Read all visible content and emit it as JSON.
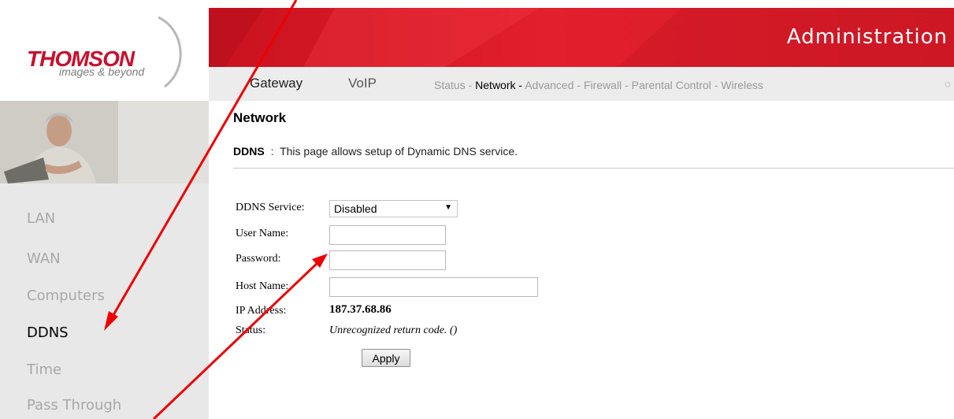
{
  "brand": {
    "logo_text": "THOMSON",
    "tagline": "images & beyond",
    "colors": {
      "primary_red": "#d61a29",
      "logo_red": "#c8102e",
      "annotation_red": "#ee0000"
    }
  },
  "banner": {
    "title": "Administration"
  },
  "nav": {
    "main": [
      "Gateway",
      "VoIP"
    ],
    "sub": [
      {
        "label": "Status",
        "active": false
      },
      {
        "label": "Network",
        "active": true
      },
      {
        "label": "Advanced",
        "active": false
      },
      {
        "label": "Firewall",
        "active": false
      },
      {
        "label": "Parental Control",
        "active": false
      },
      {
        "label": "Wireless",
        "active": false
      }
    ],
    "separator": "-",
    "trailing_icon": "loading-ring-icon"
  },
  "sidebar": {
    "items": [
      {
        "label": "LAN",
        "active": false
      },
      {
        "label": "WAN",
        "active": false
      },
      {
        "label": "Computers",
        "active": false
      },
      {
        "label": "DDNS",
        "active": true
      },
      {
        "label": "Time",
        "active": false
      },
      {
        "label": "Pass Through",
        "active": false
      }
    ]
  },
  "page": {
    "title": "Network",
    "desc_key": "DDNS",
    "desc_sep": ":",
    "desc_text": "This page allows setup of Dynamic DNS service."
  },
  "form": {
    "ddns_service_label": "DDNS Service:",
    "ddns_service_value": "Disabled",
    "user_name_label": "User Name:",
    "user_name_value": "",
    "password_label": "Password:",
    "password_value": "",
    "host_name_label": "Host Name:",
    "host_name_value": "",
    "ip_address_label": "IP Address:",
    "ip_address_value": "187.37.68.86",
    "status_label": "Status:",
    "status_value": "Unrecognized return code. ()",
    "apply_label": "Apply"
  }
}
